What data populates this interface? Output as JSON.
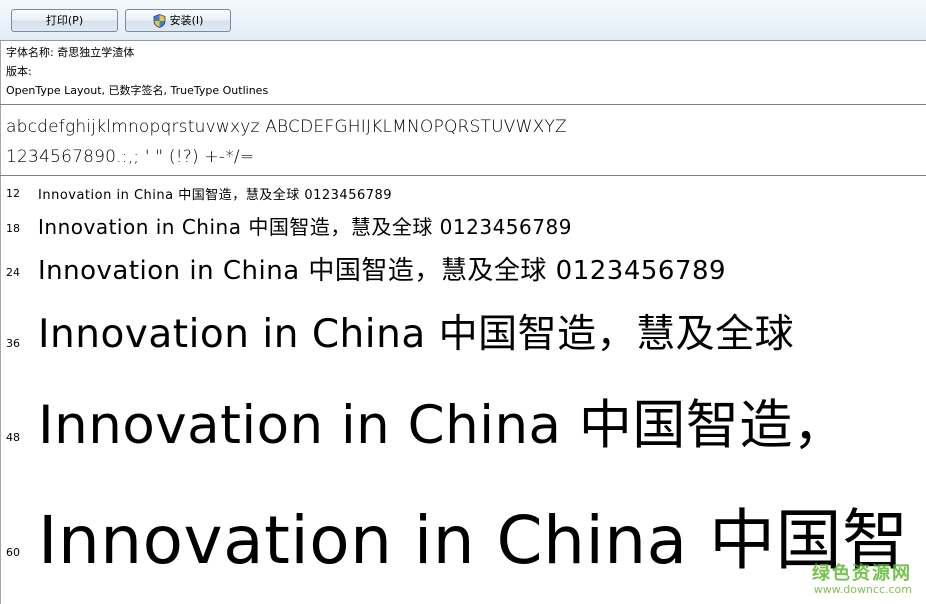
{
  "toolbar": {
    "print_label": "打印(P)",
    "install_label": "安装(I)"
  },
  "font_info": {
    "name_line": "字体名称: 奇思独立学渣体",
    "version_line": "版本:",
    "type_line": "OpenType Layout, 已数字签名, TrueType Outlines"
  },
  "charset": {
    "letters": "abcdefghijklmnopqrstuvwxyz ABCDEFGHIJKLMNOPQRSTUVWXYZ",
    "symbols": "1234567890.:,; ' \" (!?) +-*/="
  },
  "samples": [
    {
      "size": "12",
      "text": "Innovation in China 中国智造，慧及全球 0123456789"
    },
    {
      "size": "18",
      "text": "Innovation in China 中国智造，慧及全球 0123456789"
    },
    {
      "size": "24",
      "text": "Innovation in China 中国智造，慧及全球 0123456789"
    },
    {
      "size": "36",
      "text": "Innovation in China 中国智造，慧及全球"
    },
    {
      "size": "48",
      "text": "Innovation in China 中国智造，"
    },
    {
      "size": "60",
      "text": "Innovation in China 中国智"
    }
  ],
  "watermark": {
    "brand": "绿色资源网",
    "url": "www.downcc.com"
  }
}
